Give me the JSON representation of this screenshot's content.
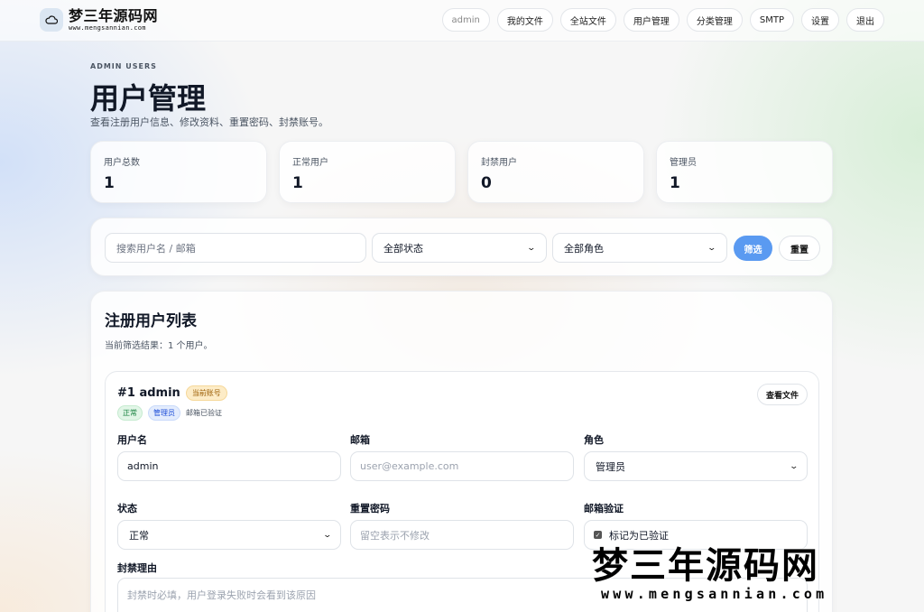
{
  "brand": {
    "name": "梦三年源码网",
    "url": "www.mengsannian.com",
    "icon": "cloud-icon"
  },
  "nav": {
    "username": "admin",
    "items": [
      "我的文件",
      "全站文件",
      "用户管理",
      "分类管理",
      "SMTP",
      "设置",
      "退出"
    ]
  },
  "header": {
    "eyebrow": "ADMIN USERS",
    "title": "用户管理",
    "description": "查看注册用户信息、修改资料、重置密码、封禁账号。"
  },
  "stats": [
    {
      "label": "用户总数",
      "value": "1"
    },
    {
      "label": "正常用户",
      "value": "1"
    },
    {
      "label": "封禁用户",
      "value": "0"
    },
    {
      "label": "管理员",
      "value": "1"
    }
  ],
  "filter": {
    "search_placeholder": "搜索用户名 / 邮箱",
    "status_selected": "全部状态",
    "role_selected": "全部角色",
    "submit_label": "筛选",
    "reset_label": "重置",
    "accent": "#5a9af1"
  },
  "list": {
    "title": "注册用户列表",
    "result_text": "当前筛选结果：1 个用户。"
  },
  "user": {
    "heading": "#1 admin",
    "current_badge": "当前账号",
    "status_tag": "正常",
    "role_tag": "管理员",
    "verified_text": "邮箱已验证",
    "view_files_label": "查看文件",
    "username_label": "用户名",
    "username_value": "admin",
    "email_label": "邮箱",
    "email_placeholder": "user@example.com",
    "role_label": "角色",
    "role_value": "管理员",
    "status_label": "状态",
    "status_value": "正常",
    "password_label": "重置密码",
    "password_placeholder": "留空表示不修改",
    "email_verify_label": "邮箱验证",
    "email_verify_checkbox": "标记为已验证",
    "email_verify_checked": true,
    "ban_reason_label": "封禁理由",
    "ban_reason_placeholder": "封禁时必填，用户登录失败时会看到该原因"
  },
  "watermark": {
    "name": "梦三年源码网",
    "url": "www.mengsannian.com"
  }
}
